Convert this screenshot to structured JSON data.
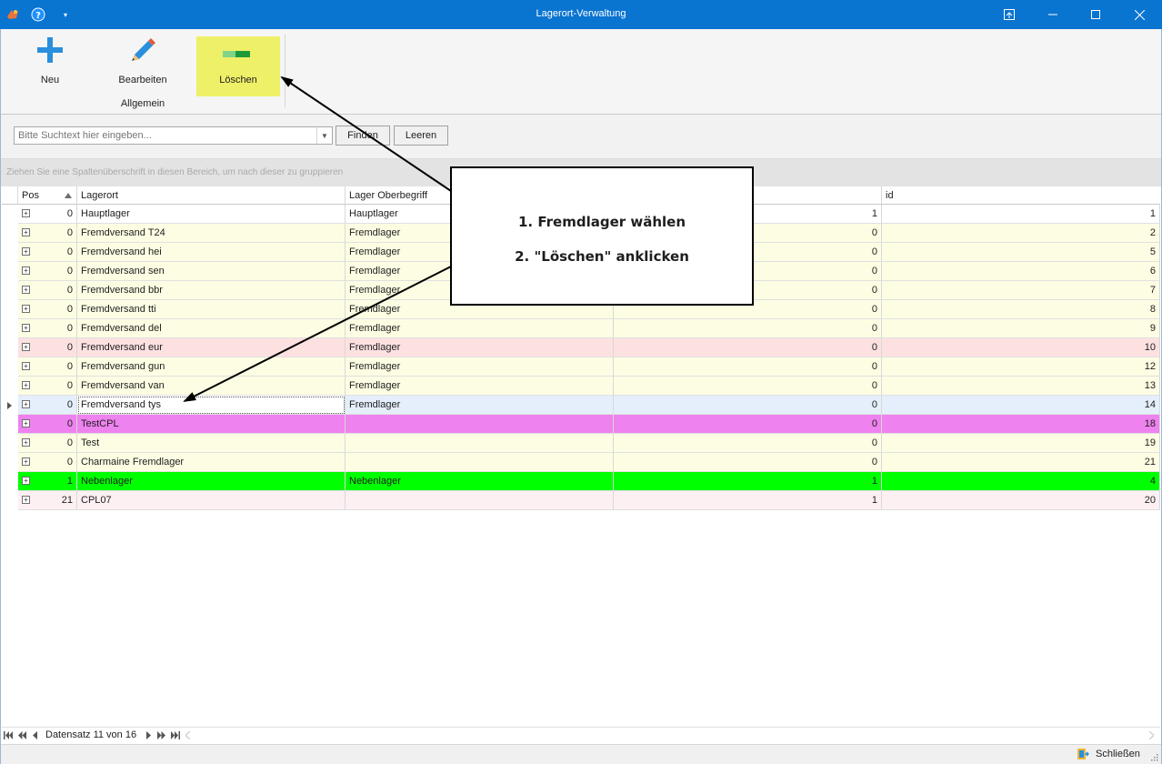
{
  "window": {
    "title": "Lagerort-Verwaltung",
    "colors": {
      "titlebar": "#0a74d1",
      "highlight": "#eef067"
    }
  },
  "ribbon": {
    "buttons": [
      {
        "label": "Neu",
        "icon": "plus-icon"
      },
      {
        "label": "Bearbeiten",
        "icon": "pencil-icon"
      },
      {
        "label": "Löschen",
        "icon": "minus-icon"
      }
    ],
    "group_label": "Allgemein"
  },
  "search": {
    "placeholder": "Bitte Suchtext hier eingeben...",
    "value": "",
    "find_label": "Finden",
    "clear_label": "Leeren"
  },
  "group_panel": {
    "hint": "Ziehen Sie eine Spaltenüberschrift in diesen Bereich, um nach dieser zu gruppieren"
  },
  "grid": {
    "columns": [
      {
        "label": "Pos",
        "sort": "ascending"
      },
      {
        "label": "Lagerort"
      },
      {
        "label": "Lager Oberbegriff"
      },
      {
        "label": ""
      },
      {
        "label": "id"
      }
    ],
    "rows": [
      {
        "pos": "0",
        "lagerort": "Hauptlager",
        "oberbegriff": "Hauptlager",
        "flag": "1",
        "id": "1",
        "color": "#ffffff"
      },
      {
        "pos": "0",
        "lagerort": "Fremdversand T24",
        "oberbegriff": "Fremdlager",
        "flag": "0",
        "id": "2",
        "color": "#fdfde3"
      },
      {
        "pos": "0",
        "lagerort": "Fremdversand hei",
        "oberbegriff": "Fremdlager",
        "flag": "0",
        "id": "5",
        "color": "#fdfde3"
      },
      {
        "pos": "0",
        "lagerort": "Fremdversand sen",
        "oberbegriff": "Fremdlager",
        "flag": "0",
        "id": "6",
        "color": "#fdfde3"
      },
      {
        "pos": "0",
        "lagerort": "Fremdversand bbr",
        "oberbegriff": "Fremdlager",
        "flag": "0",
        "id": "7",
        "color": "#fdfde3"
      },
      {
        "pos": "0",
        "lagerort": "Fremdversand tti",
        "oberbegriff": "Fremdlager",
        "flag": "0",
        "id": "8",
        "color": "#fdfde3"
      },
      {
        "pos": "0",
        "lagerort": "Fremdversand del",
        "oberbegriff": "Fremdlager",
        "flag": "0",
        "id": "9",
        "color": "#fdfde3"
      },
      {
        "pos": "0",
        "lagerort": "Fremdversand eur",
        "oberbegriff": "Fremdlager",
        "flag": "0",
        "id": "10",
        "color": "#fde1e1"
      },
      {
        "pos": "0",
        "lagerort": "Fremdversand gun",
        "oberbegriff": "Fremdlager",
        "flag": "0",
        "id": "12",
        "color": "#fdfde3"
      },
      {
        "pos": "0",
        "lagerort": "Fremdversand van",
        "oberbegriff": "Fremdlager",
        "flag": "0",
        "id": "13",
        "color": "#fdfde3"
      },
      {
        "pos": "0",
        "lagerort": "Fremdversand tys",
        "oberbegriff": "Fremdlager",
        "flag": "0",
        "id": "14",
        "color": "#e5effb",
        "selected": true
      },
      {
        "pos": "0",
        "lagerort": "TestCPL",
        "oberbegriff": "",
        "flag": "0",
        "id": "18",
        "color": "#ee82ee"
      },
      {
        "pos": "0",
        "lagerort": "Test",
        "oberbegriff": "",
        "flag": "0",
        "id": "19",
        "color": "#fdfde3"
      },
      {
        "pos": "0",
        "lagerort": "Charmaine Fremdlager",
        "oberbegriff": "",
        "flag": "0",
        "id": "21",
        "color": "#fdfde3"
      },
      {
        "pos": "1",
        "lagerort": "Nebenlager",
        "oberbegriff": "Nebenlager",
        "flag": "1",
        "id": "4",
        "color": "#00ff00"
      },
      {
        "pos": "21",
        "lagerort": "CPL07",
        "oberbegriff": "",
        "flag": "1",
        "id": "20",
        "color": "#fdf0f3"
      }
    ]
  },
  "navigator": {
    "record_text": "Datensatz 11 von 16"
  },
  "statusbar": {
    "close_label": "Schließen"
  },
  "annotation": {
    "line1": "1. Fremdlager wählen",
    "line2": "2. \"Löschen\" anklicken"
  }
}
